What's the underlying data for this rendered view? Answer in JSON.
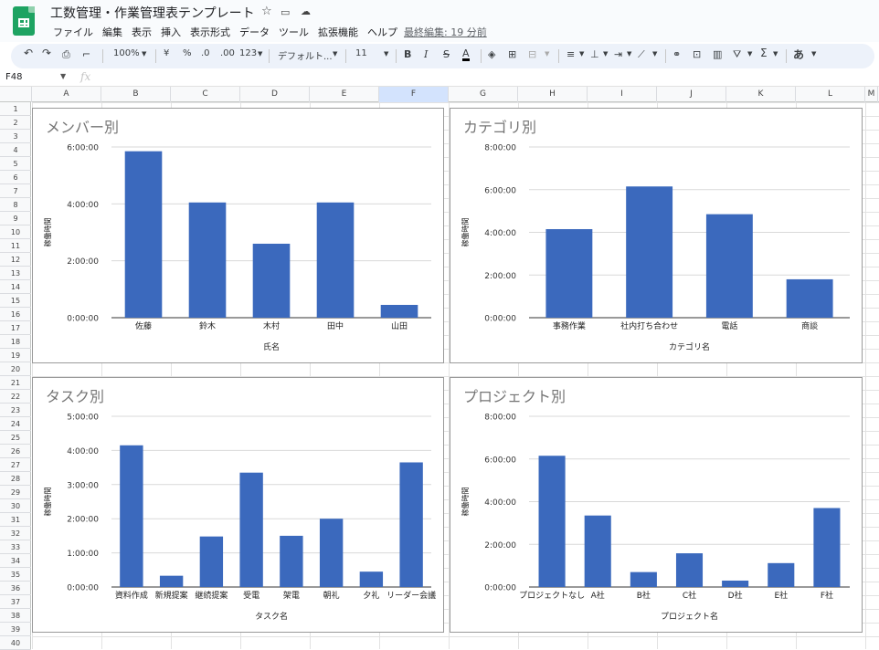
{
  "app": {
    "title": "工数管理・作業管理表テンプレート",
    "menus": [
      "ファイル",
      "編集",
      "表示",
      "挿入",
      "表示形式",
      "データ",
      "ツール",
      "拡張機能",
      "ヘルプ"
    ],
    "last_edit": "最終編集: 19 分前"
  },
  "toolbar": {
    "zoom": "100%",
    "currency": "¥",
    "percent": "%",
    "dec_decrease": ".0",
    "dec_increase": ".00",
    "number_format": "123",
    "font": "デフォルト...",
    "font_size": "11",
    "bold": "B",
    "italic": "I",
    "strike": "S",
    "text_color": "A",
    "ime": "あ"
  },
  "formula_bar": {
    "cell_ref": "F48",
    "fx": "fx"
  },
  "columns": [
    "A",
    "B",
    "C",
    "D",
    "E",
    "F",
    "G",
    "H",
    "I",
    "J",
    "K",
    "L",
    "M"
  ],
  "rows": [
    "1",
    "2",
    "3",
    "4",
    "5",
    "6",
    "7",
    "8",
    "9",
    "10",
    "11",
    "12",
    "13",
    "14",
    "15",
    "16",
    "17",
    "18",
    "19",
    "20",
    "21",
    "22",
    "23",
    "24",
    "25",
    "26",
    "27",
    "28",
    "29",
    "30",
    "31",
    "32",
    "33",
    "34",
    "35",
    "36",
    "37",
    "38",
    "39",
    "40"
  ],
  "colors": {
    "bar": "#3b69bd",
    "accent": "#1ea362"
  },
  "chart_data": [
    {
      "type": "bar",
      "title": "メンバー別",
      "xlabel": "氏名",
      "ylabel": "稼働時間",
      "categories": [
        "佐藤",
        "鈴木",
        "木村",
        "田中",
        "山田"
      ],
      "values": [
        5.85,
        4.05,
        2.6,
        4.05,
        0.45
      ],
      "ylim": [
        0,
        6
      ],
      "yticks": [
        "0:00:00",
        "2:00:00",
        "4:00:00",
        "6:00:00"
      ],
      "ytick_values": [
        0,
        2,
        4,
        6
      ]
    },
    {
      "type": "bar",
      "title": "カテゴリ別",
      "xlabel": "カテゴリ名",
      "ylabel": "稼働時間",
      "categories": [
        "事務作業",
        "社内打ち合わせ",
        "電話",
        "商談"
      ],
      "values": [
        4.15,
        6.15,
        4.85,
        1.8
      ],
      "ylim": [
        0,
        8
      ],
      "yticks": [
        "0:00:00",
        "2:00:00",
        "4:00:00",
        "6:00:00",
        "8:00:00"
      ],
      "ytick_values": [
        0,
        2,
        4,
        6,
        8
      ]
    },
    {
      "type": "bar",
      "title": "タスク別",
      "xlabel": "タスク名",
      "ylabel": "稼働時間",
      "categories": [
        "資料作成",
        "新規提案",
        "継続提案",
        "受電",
        "架電",
        "朝礼",
        "夕礼",
        "リーダー会議"
      ],
      "values": [
        4.15,
        0.33,
        1.48,
        3.35,
        1.5,
        2.0,
        0.45,
        3.65
      ],
      "ylim": [
        0,
        5
      ],
      "yticks": [
        "0:00:00",
        "1:00:00",
        "2:00:00",
        "3:00:00",
        "4:00:00",
        "5:00:00"
      ],
      "ytick_values": [
        0,
        1,
        2,
        3,
        4,
        5
      ]
    },
    {
      "type": "bar",
      "title": "プロジェクト別",
      "xlabel": "プロジェクト名",
      "ylabel": "稼働時間",
      "categories": [
        "プロジェクトなし",
        "A社",
        "B社",
        "C社",
        "D社",
        "E社",
        "F社"
      ],
      "values": [
        6.15,
        3.35,
        0.7,
        1.58,
        0.3,
        1.12,
        3.7
      ],
      "ylim": [
        0,
        8
      ],
      "yticks": [
        "0:00:00",
        "2:00:00",
        "4:00:00",
        "6:00:00",
        "8:00:00"
      ],
      "ytick_values": [
        0,
        2,
        4,
        6,
        8
      ]
    }
  ]
}
